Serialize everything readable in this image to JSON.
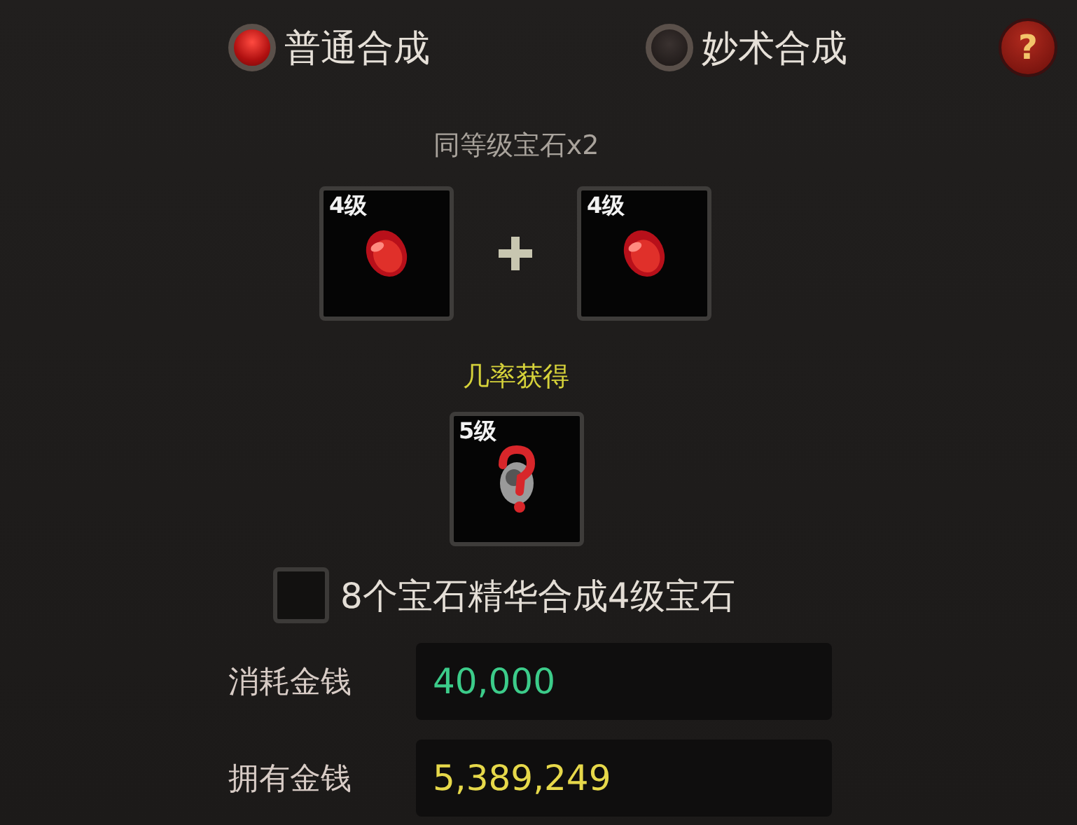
{
  "modes": [
    {
      "label": "普通合成",
      "selected": true
    },
    {
      "label": "妙术合成",
      "selected": false
    }
  ],
  "help": {
    "label": "?"
  },
  "requirement": "同等级宝石x2",
  "inputs": [
    {
      "level": "4级",
      "kind": "gem"
    },
    {
      "level": "4级",
      "kind": "gem"
    }
  ],
  "result_caption": "几率获得",
  "result": {
    "level": "5级",
    "kind": "unknown"
  },
  "essence_option": {
    "label": "8个宝石精华合成4级宝石",
    "checked": false
  },
  "money": [
    {
      "label": "消耗金钱",
      "value": "40,000",
      "kind": "cost"
    },
    {
      "label": "拥有金钱",
      "value": "5,389,249",
      "kind": "owned"
    }
  ]
}
